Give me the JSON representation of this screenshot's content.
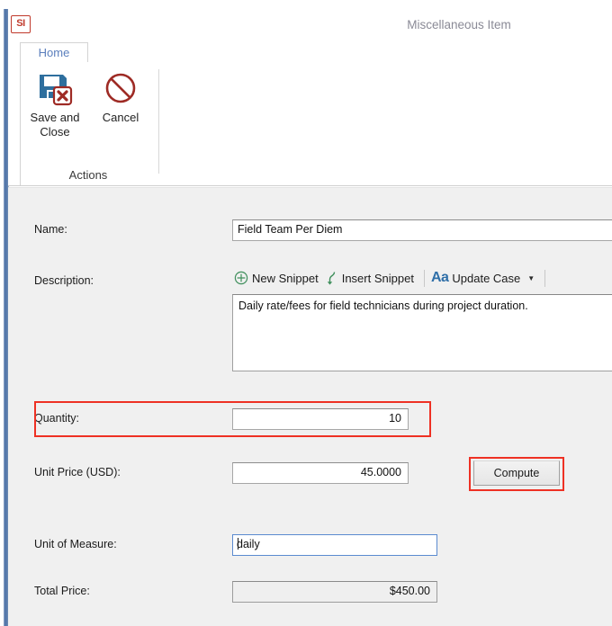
{
  "window": {
    "app_badge": "SI",
    "title": "Miscellaneous Item",
    "accent_border": "#4a6fa5",
    "panel_bg": "#f0f0f0",
    "highlight_color": "#ee3124"
  },
  "ribbon": {
    "tabs": [
      {
        "label": "Home",
        "active": true
      }
    ],
    "groups": [
      {
        "label": "Actions",
        "buttons": [
          {
            "label_line1": "Save and",
            "label_line2": "Close",
            "icon": "save-and-close-icon"
          },
          {
            "label_line1": "Cancel",
            "label_line2": "",
            "icon": "cancel-prohibition-icon"
          }
        ]
      }
    ]
  },
  "form": {
    "name": {
      "label": "Name:",
      "value": "Field Team Per Diem",
      "placeholder": ""
    },
    "description": {
      "label": "Description:",
      "value": "Daily rate/fees for field technicians during project duration.",
      "placeholder": "",
      "toolbar": [
        {
          "label": "New Snippet",
          "icon": "plus-circle-icon"
        },
        {
          "label": "Insert Snippet",
          "icon": "arrow-down-curve-icon"
        },
        {
          "label": "Update Case",
          "icon": "update-case-aa-icon",
          "has_dropdown": true
        }
      ]
    },
    "quantity": {
      "label": "Quantity:",
      "value": "10",
      "placeholder": "",
      "highlighted": true
    },
    "unit_price": {
      "label": "Unit Price (USD):",
      "value": "45.0000",
      "placeholder": ""
    },
    "compute": {
      "label": "Compute",
      "highlighted": true
    },
    "unit_of_measure": {
      "label": "Unit of Measure:",
      "value": "daily",
      "placeholder": "",
      "focused": true
    },
    "total_price": {
      "label": "Total Price:",
      "value": "$450.00",
      "readonly": true
    }
  }
}
